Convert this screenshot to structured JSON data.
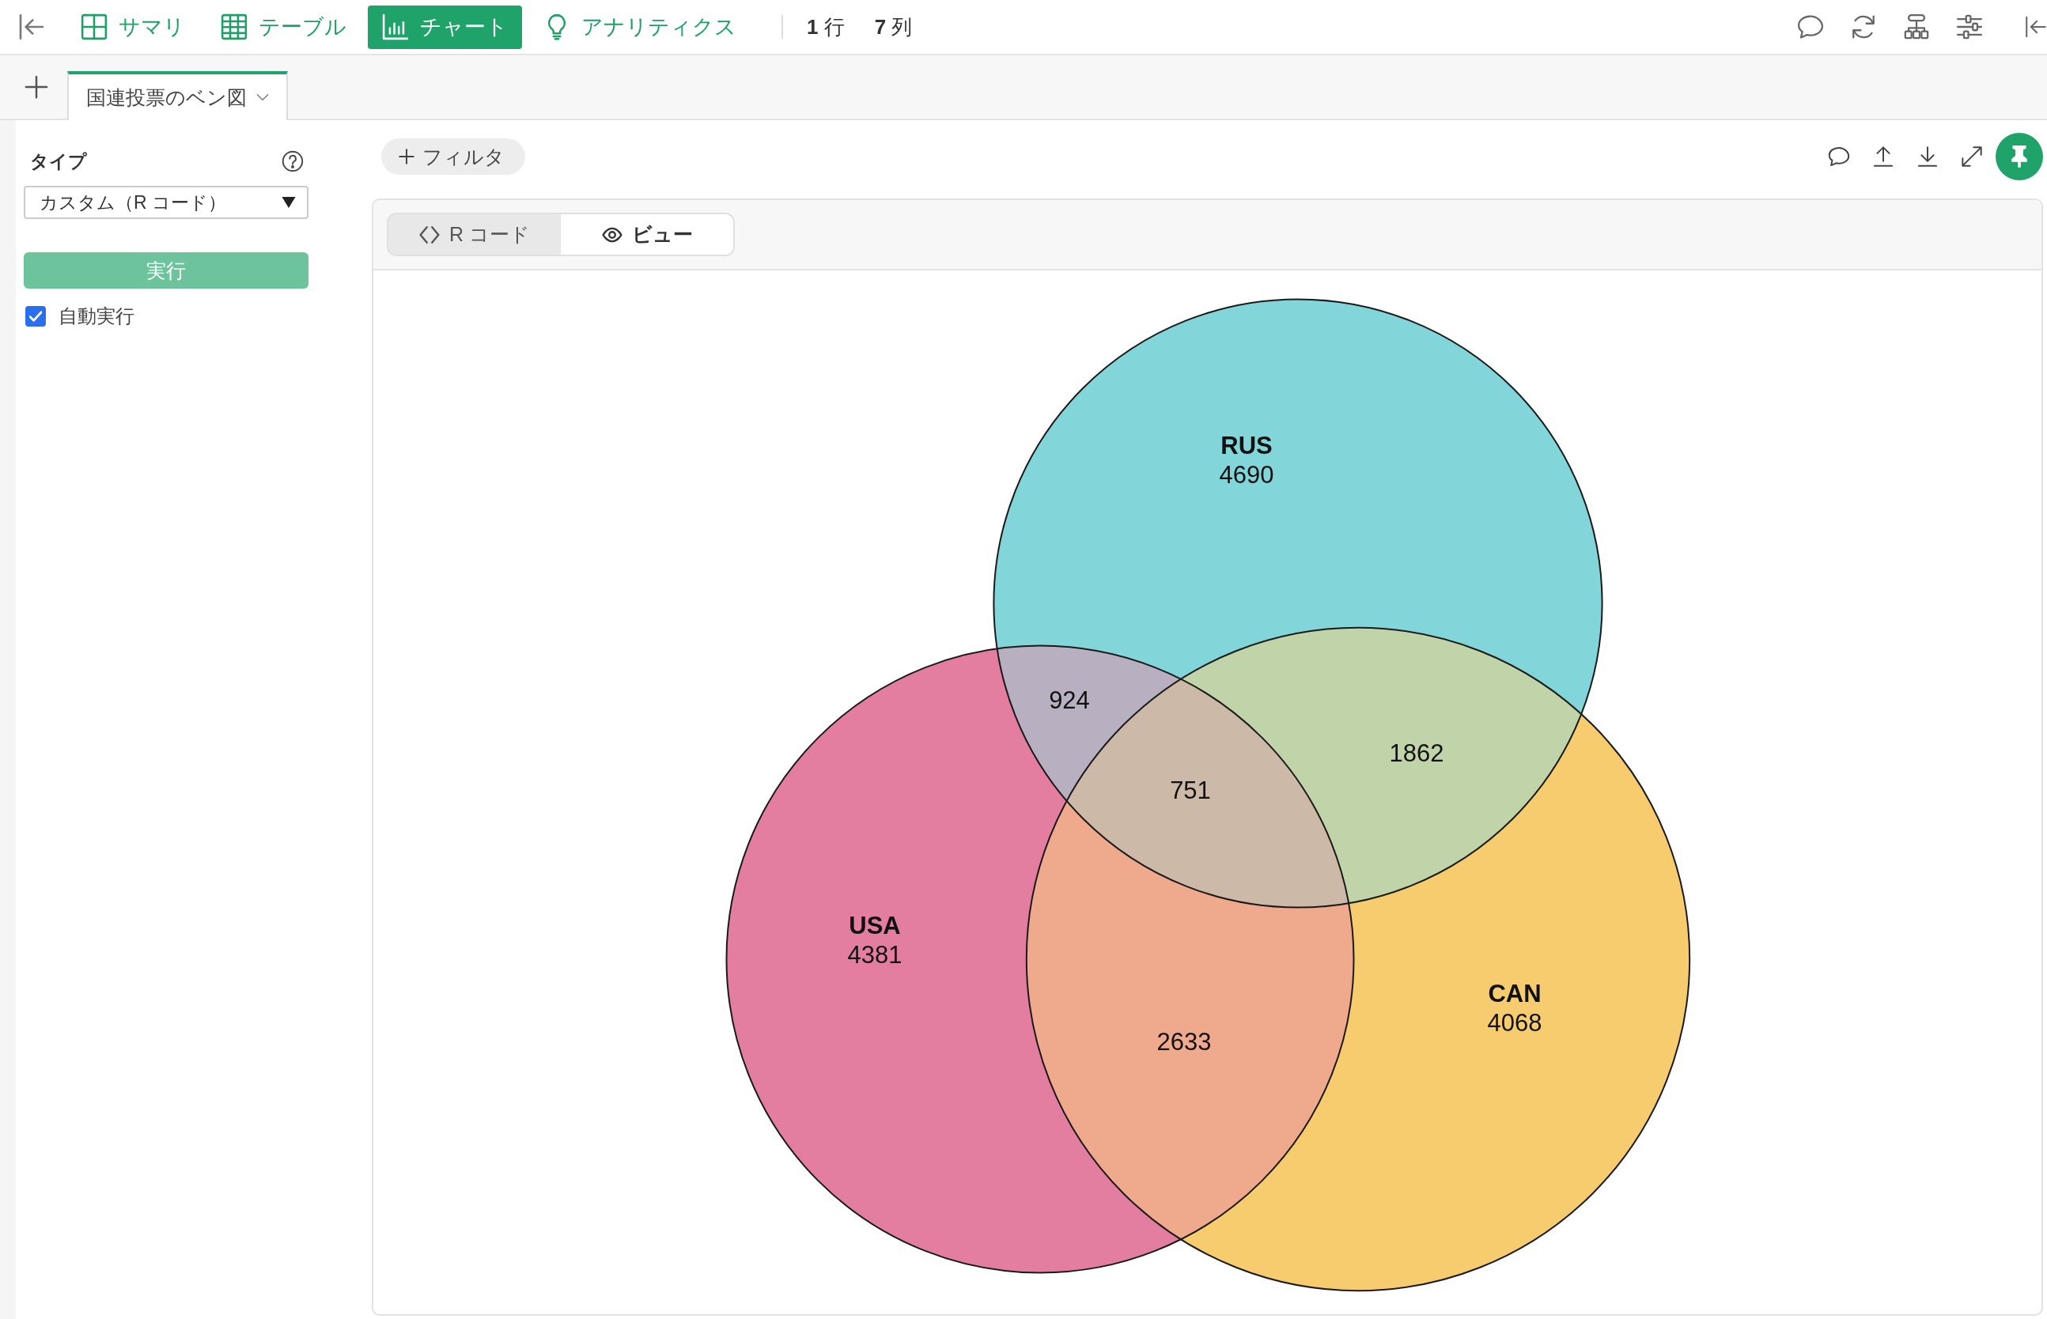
{
  "toolbar": {
    "nav": [
      {
        "label": "サマリ",
        "selected": false
      },
      {
        "label": "テーブル",
        "selected": false
      },
      {
        "label": "チャート",
        "selected": true
      },
      {
        "label": "アナリティクス",
        "selected": false
      }
    ],
    "counts": [
      "**1** 行",
      "**7** 列"
    ]
  },
  "tabs": [
    {
      "label": "国連投票のベン図",
      "selected": true
    }
  ],
  "side_panel": {
    "type_label": "タイプ",
    "type_select": {
      "value": "カスタム（R コード）"
    },
    "run_button": {
      "label": "実行",
      "disabled": true
    },
    "auto_run": {
      "label": "自動実行",
      "checked": true
    }
  },
  "chart_toolbar": {
    "filter_button": "フィルタ"
  },
  "view_tabs": [
    {
      "label": "R コード",
      "selected": false
    },
    {
      "label": "ビュー",
      "selected": true
    }
  ],
  "venn": {
    "sets": [
      {
        "name": "RUS",
        "count": "4690",
        "color": "#82d5d9"
      },
      {
        "name": "USA",
        "count": "4381",
        "color": "#e47ea0"
      },
      {
        "name": "CAN",
        "count": "4068",
        "color": "#f7cc6e"
      }
    ],
    "overlaps": [
      {
        "label": "924"
      },
      {
        "label": "1862"
      },
      {
        "label": "751"
      },
      {
        "label": "2633"
      }
    ]
  }
}
